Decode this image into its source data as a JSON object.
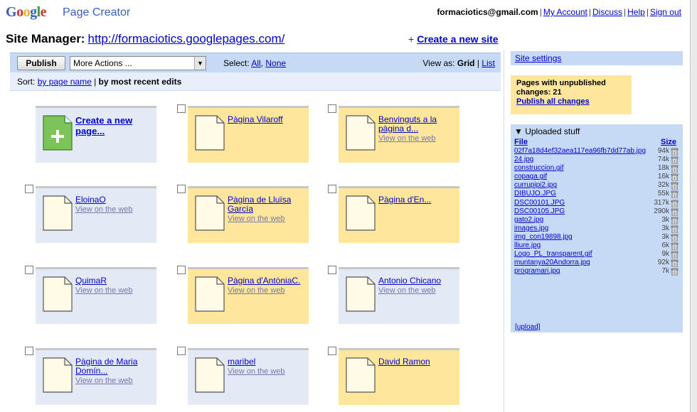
{
  "header": {
    "logo_text": "Google",
    "product_name": "Page Creator",
    "email": "formaciotics@gmail.com",
    "links": [
      "My Account",
      "Discuss",
      "Help",
      "Sign out"
    ]
  },
  "site": {
    "title_label": "Site Manager:",
    "url": "http://formaciotics.googlepages.com/",
    "create_plus": "+",
    "create_label": "Create a new site"
  },
  "toolbar": {
    "publish_label": "Publish",
    "more_actions_label": "More Actions ...",
    "select_label": "Select:",
    "select_all": "All",
    "select_none": "None",
    "view_as_label": "View as:",
    "view_grid": "Grid",
    "view_list": "List"
  },
  "sort": {
    "label": "Sort:",
    "by_name": "by page name",
    "by_recent": "by most recent edits"
  },
  "pages": [
    {
      "name": "Create a new page...",
      "view": "",
      "color": "blue",
      "create": true
    },
    {
      "name": "Pàgina Vilaroff",
      "view": "",
      "color": "yellow"
    },
    {
      "name": "Benvinguts a la pàgina d...",
      "view": "View on the web",
      "color": "yellow"
    },
    {
      "name": "EloinaO",
      "view": "View on the web",
      "color": "blue"
    },
    {
      "name": "Pàgina de Lluïsa García",
      "view": "View on the web",
      "color": "yellow"
    },
    {
      "name": "          Pàgina d'En...",
      "view": "",
      "color": "yellow"
    },
    {
      "name": "QuimaR",
      "view": "View on the web",
      "color": "blue"
    },
    {
      "name": "Pàgina d'AntòniaC.",
      "view": "View on the web",
      "color": "yellow"
    },
    {
      "name": "Antonio Chicano",
      "view": "View on the web",
      "color": "blue"
    },
    {
      "name": " Pàgina de Maria Domín...",
      "view": "View on the web",
      "color": "blue"
    },
    {
      "name": "maribel",
      "view": "View on the web",
      "color": "blue"
    },
    {
      "name": "David Ramon",
      "view": "",
      "color": "yellow"
    }
  ],
  "right_panel": {
    "site_settings": "Site settings",
    "unpublished_label": "Pages with unpublished changes: 21",
    "publish_all": "Publish all changes",
    "uploaded_header": "▼ Uploaded stuff",
    "col_file": "File",
    "col_size": "Size",
    "files": [
      {
        "name": "02f7a18d4ef32aea117ea96fb7dd77ab.jpg",
        "size": "94k"
      },
      {
        "name": "24.jpg",
        "size": "74k"
      },
      {
        "name": "construccion.gif",
        "size": "18k"
      },
      {
        "name": "copaga.gif",
        "size": "16k"
      },
      {
        "name": "currupipi2.jpg",
        "size": "32k"
      },
      {
        "name": "DIBUJO.JPG",
        "size": "55k"
      },
      {
        "name": "DSC00101.JPG",
        "size": "317k"
      },
      {
        "name": "DSC00105.JPG",
        "size": "290k"
      },
      {
        "name": "gato2.jpg",
        "size": "3k"
      },
      {
        "name": "images.jpg",
        "size": "3k"
      },
      {
        "name": "img_con19898.jpg",
        "size": "3k"
      },
      {
        "name": "lliure.jpg",
        "size": "6k"
      },
      {
        "name": "Logo_PL_transparent.gif",
        "size": "9k"
      },
      {
        "name": "muntanya20Andorra.jpg",
        "size": "92k"
      },
      {
        "name": "programari.jpg",
        "size": "7k"
      }
    ],
    "upload_link": "[upload]"
  },
  "colors": {
    "toolbar_blue": "#c6d9f5",
    "tile_blue": "#e3eaf6",
    "tile_yellow": "#ffe69d",
    "link": "#0000cc",
    "create_green": "#7cc35a"
  }
}
